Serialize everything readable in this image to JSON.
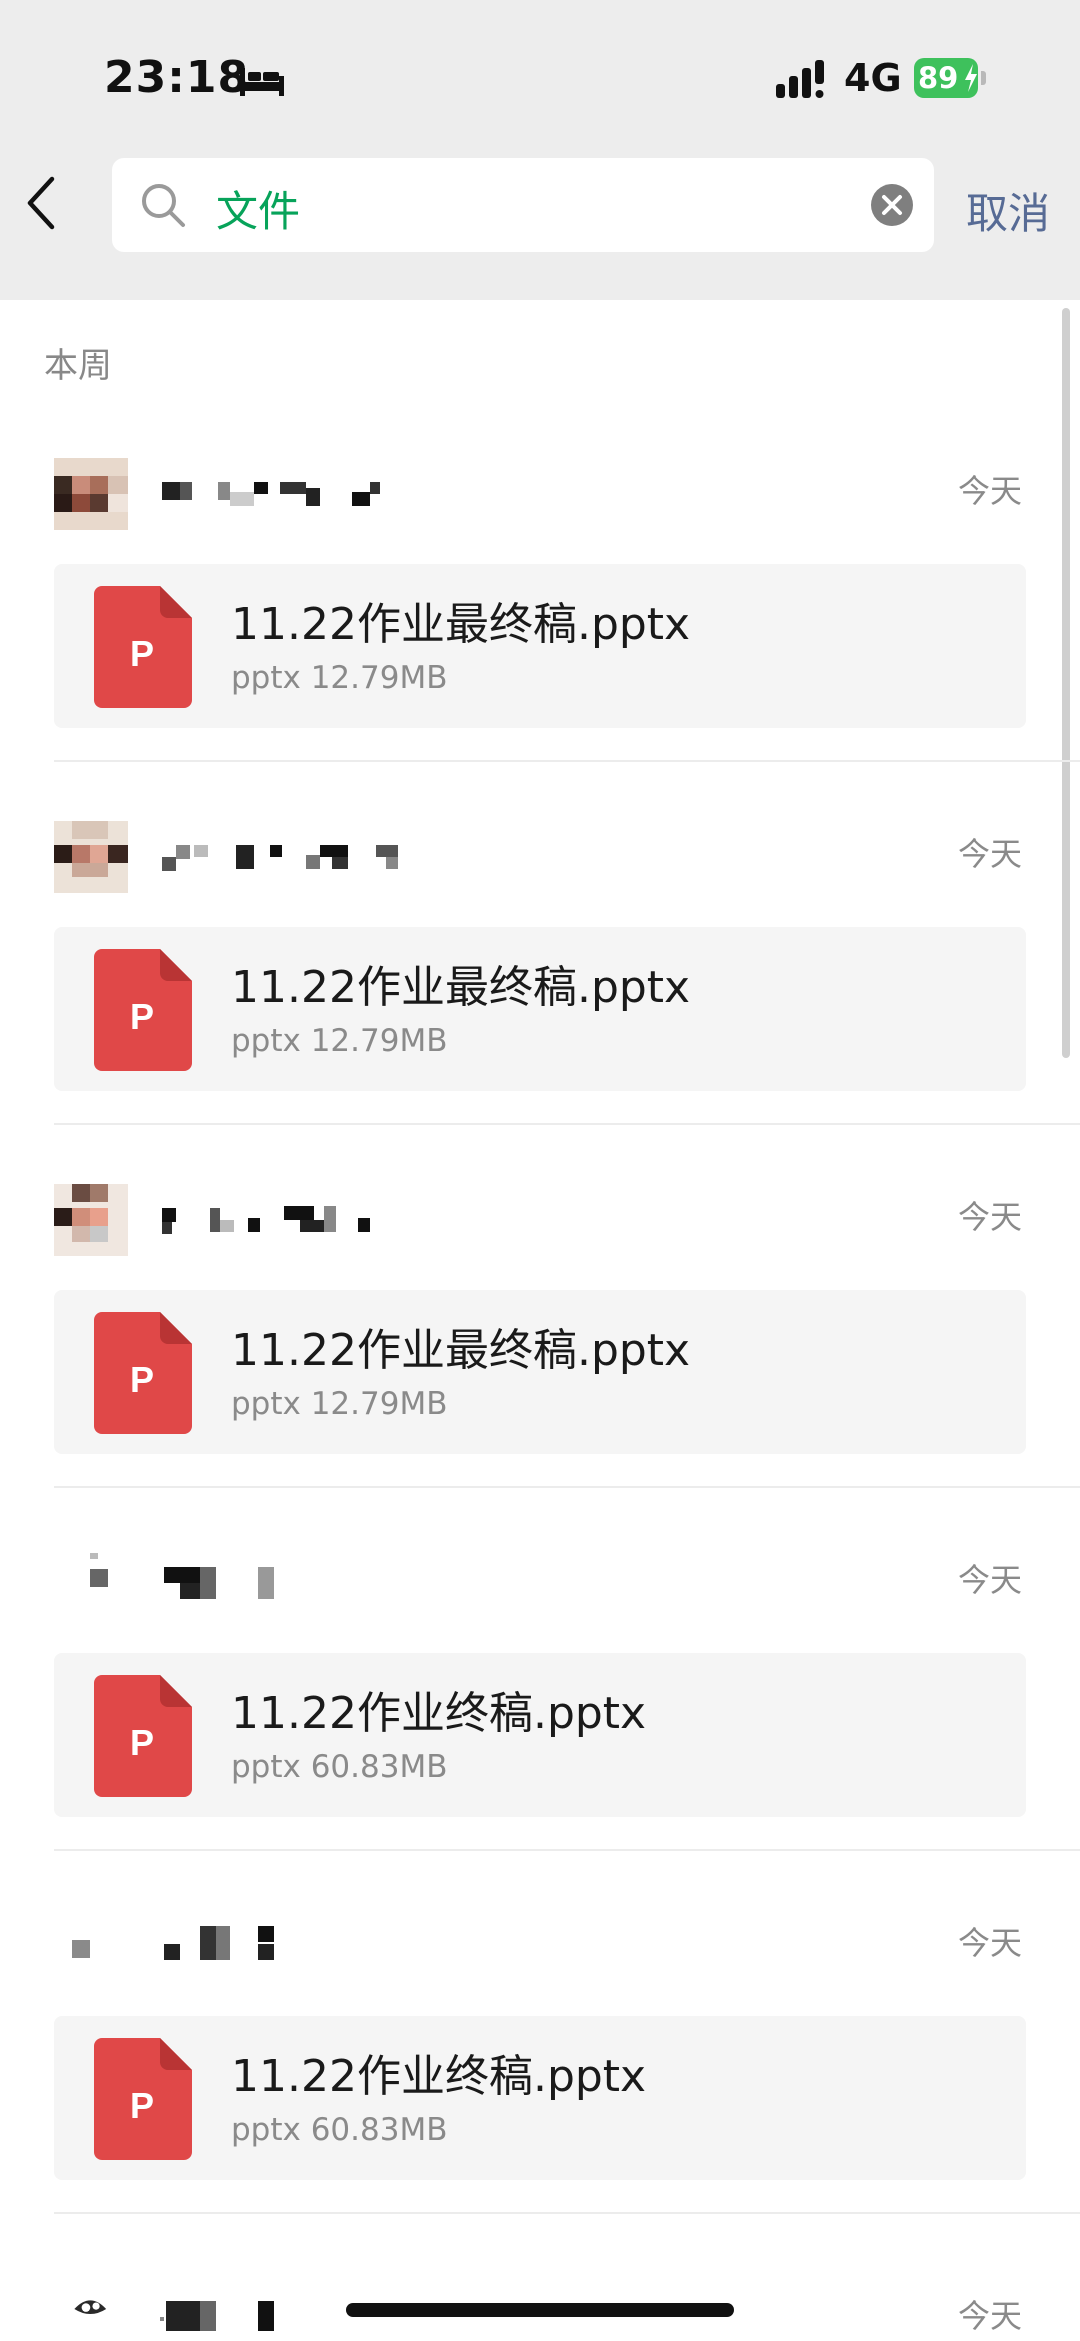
{
  "status_bar": {
    "time": "23:18",
    "network": "4G",
    "battery": "89"
  },
  "search": {
    "query": "文件",
    "cancel_label": "取消"
  },
  "section_title": "本周",
  "files": [
    {
      "date": "今天",
      "file_name": "11.22作业最终稿.pptx",
      "file_meta": "pptx 12.79MB",
      "file_type_letter": "P"
    },
    {
      "date": "今天",
      "file_name": "11.22作业最终稿.pptx",
      "file_meta": "pptx 12.79MB",
      "file_type_letter": "P"
    },
    {
      "date": "今天",
      "file_name": "11.22作业最终稿.pptx",
      "file_meta": "pptx 12.79MB",
      "file_type_letter": "P"
    },
    {
      "date": "今天",
      "file_name": "11.22作业终稿.pptx",
      "file_meta": "pptx 60.83MB",
      "file_type_letter": "P"
    },
    {
      "date": "今天",
      "file_name": "11.22作业终稿.pptx",
      "file_meta": "pptx 60.83MB",
      "file_type_letter": "P"
    },
    {
      "date": "今天"
    }
  ],
  "colors": {
    "accent_green": "#07a35a",
    "link_blue": "#576b95",
    "ppt_red": "#e04848",
    "battery_green": "#3ec15c"
  },
  "icons": [
    "bed-icon",
    "signal-icon",
    "battery-icon",
    "back-icon",
    "search-icon",
    "clear-icon",
    "ppt-file-icon"
  ]
}
